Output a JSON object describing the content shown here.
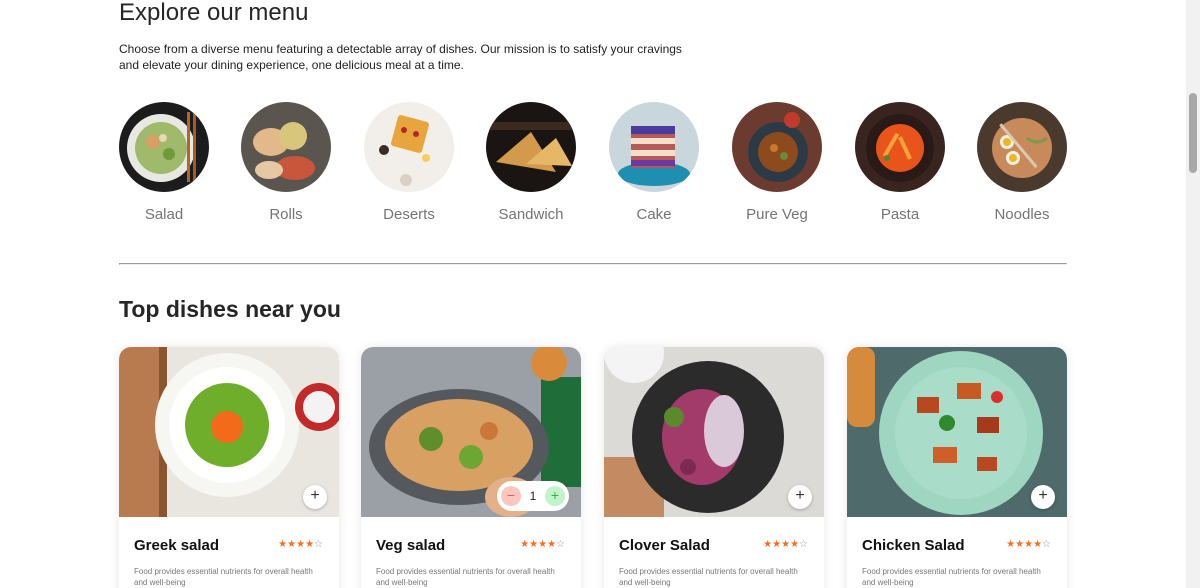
{
  "explore": {
    "title": "Explore our menu",
    "description": "Choose from a diverse menu featuring a detectable array of dishes. Our mission is to satisfy your cravings and elevate your dining experience, one delicious meal at a time."
  },
  "menu": [
    {
      "label": "Salad"
    },
    {
      "label": "Rolls"
    },
    {
      "label": "Deserts"
    },
    {
      "label": "Sandwich"
    },
    {
      "label": "Cake"
    },
    {
      "label": "Pure Veg"
    },
    {
      "label": "Pasta"
    },
    {
      "label": "Noodles"
    }
  ],
  "dishes": {
    "title": "Top dishes near you",
    "items": [
      {
        "name": "Greek salad",
        "rating": 4,
        "desc": "Food provides essential nutrients for overall health and well-being",
        "add_label": "+"
      },
      {
        "name": "Veg salad",
        "rating": 4,
        "desc": "Food provides essential nutrients for overall health and well-being",
        "minus_label": "−",
        "count": "1",
        "plus_label": "+"
      },
      {
        "name": "Clover Salad",
        "rating": 4,
        "desc": "Food provides essential nutrients for overall health and well-being",
        "add_label": "+"
      },
      {
        "name": "Chicken Salad",
        "rating": 4,
        "desc": "Food provides essential nutrients for overall health and well-being",
        "add_label": "+"
      }
    ]
  },
  "stars": {
    "filled": "★★★★",
    "empty": "☆"
  },
  "colors": {
    "accent": "#ff6b1f",
    "minus": "#fbc5c0",
    "plus": "#c3f3c9"
  }
}
